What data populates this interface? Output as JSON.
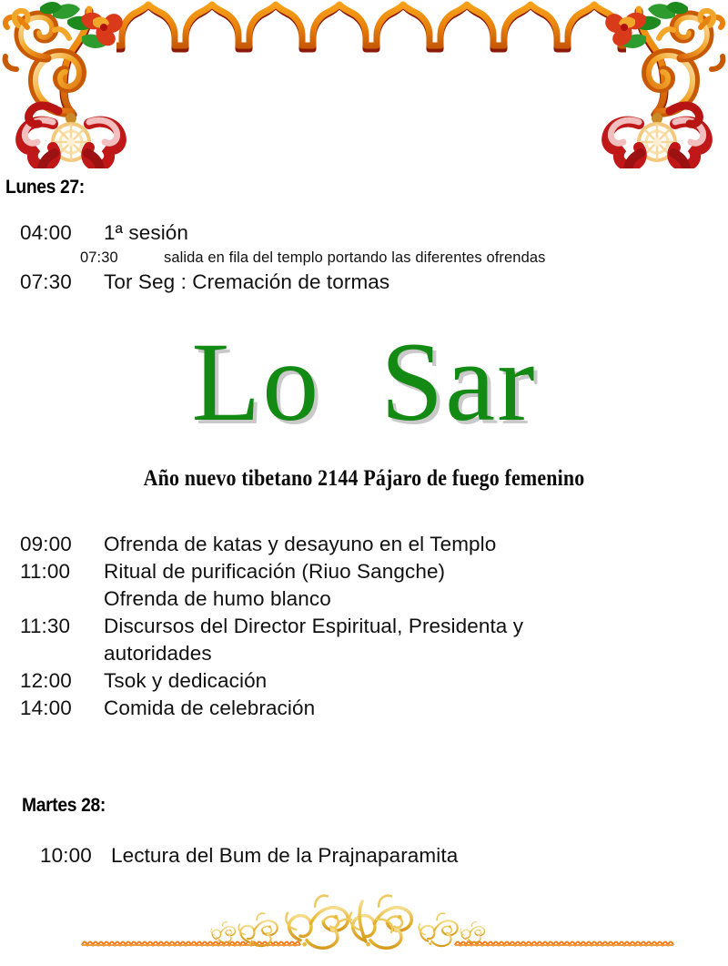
{
  "page": {
    "background_color": "#ffffff",
    "accent_green": "#138A13",
    "border_orange": "#E8820C",
    "border_dark_red": "#8B1A0A",
    "filigree_gold": "#E8B93A"
  },
  "title": {
    "text": "Lo  Sar",
    "color": "#138A13",
    "shadow_color": "#c9c9c9"
  },
  "subtitle": {
    "text": "Año nuevo tibetano 2144 Pájaro de fuego femenino"
  },
  "days": [
    {
      "heading": "Lunes 27:",
      "entries_before_title": [
        {
          "time": "04:00",
          "desc": "1ª sesión",
          "indent": false
        },
        {
          "time": "07:30",
          "desc": "salida en fila del templo portando las diferentes ofrendas",
          "indent": true
        },
        {
          "time": "07:30",
          "desc": "Tor Seg : Cremación de tormas",
          "indent": false
        }
      ],
      "entries_after_title": [
        {
          "time": "09:00",
          "desc": "Ofrenda de katas y desayuno en el Templo",
          "cont": ""
        },
        {
          "time": "11:00",
          "desc": "Ritual de purificación (Riuo Sangche)",
          "cont": "Ofrenda de humo blanco"
        },
        {
          "time": "11:30",
          "desc": "Discursos del Director Espiritual, Presidenta y",
          "cont": "autoridades"
        },
        {
          "time": "12:00",
          "desc": "Tsok y dedicación",
          "cont": ""
        },
        {
          "time": "14:00",
          "desc": "Comida de celebración",
          "cont": ""
        }
      ]
    },
    {
      "heading": "Martes 28:",
      "entries": [
        {
          "time": "10:00",
          "desc": "Lectura del Bum de la Prajnaparamita"
        }
      ]
    }
  ],
  "ornaments": {
    "top_border": "floral-scroll-corner-border-with-ogee-arches",
    "bottom_border": "gold-filigree-flourish-with-scalloped-rules",
    "arch_count": 8
  }
}
